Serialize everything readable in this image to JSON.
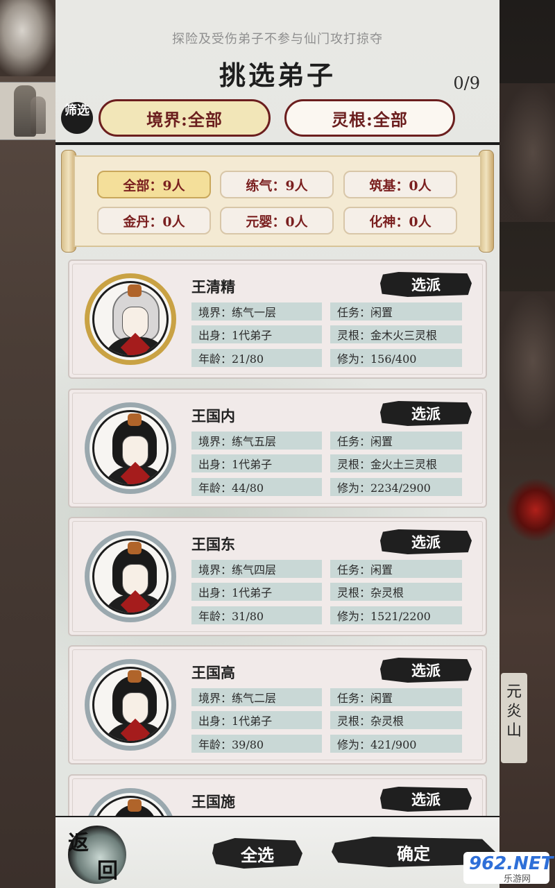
{
  "header": {
    "hint": "探险及受伤弟子不参与仙门攻打掠夺",
    "title": "挑选弟子",
    "count": "0/9",
    "filter_badge": "筛选",
    "realm_filter": "境界:全部",
    "root_filter": "灵根:全部"
  },
  "realm_tabs": [
    {
      "label": "全部：9人",
      "active": true
    },
    {
      "label": "练气：9人",
      "active": false
    },
    {
      "label": "筑基：0人",
      "active": false
    },
    {
      "label": "金丹：0人",
      "active": false
    },
    {
      "label": "元婴：0人",
      "active": false
    },
    {
      "label": "化神：0人",
      "active": false
    }
  ],
  "disciples": [
    {
      "name": "王清精",
      "assign": "选派",
      "realm": "境界：练气一层",
      "task": "任务：闲置",
      "origin": "出身：1代弟子",
      "root": "灵根：金木火三灵根",
      "age": "年龄：21/80",
      "cultivation": "修为：156/400"
    },
    {
      "name": "王国内",
      "assign": "选派",
      "realm": "境界：练气五层",
      "task": "任务：闲置",
      "origin": "出身：1代弟子",
      "root": "灵根：金火土三灵根",
      "age": "年龄：44/80",
      "cultivation": "修为：2234/2900"
    },
    {
      "name": "王国东",
      "assign": "选派",
      "realm": "境界：练气四层",
      "task": "任务：闲置",
      "origin": "出身：1代弟子",
      "root": "灵根：杂灵根",
      "age": "年龄：31/80",
      "cultivation": "修为：1521/2200"
    },
    {
      "name": "王国高",
      "assign": "选派",
      "realm": "境界：练气二层",
      "task": "任务：闲置",
      "origin": "出身：1代弟子",
      "root": "灵根：杂灵根",
      "age": "年龄：39/80",
      "cultivation": "修为：421/900"
    },
    {
      "name": "王国施",
      "assign": "选派"
    }
  ],
  "bottom": {
    "back_top": "返",
    "back_bottom": "回",
    "select_all": "全选",
    "confirm": "确定"
  },
  "side": {
    "place_name": "元炎山"
  },
  "watermark": {
    "number": "962.NET",
    "sub": "乐游网"
  },
  "colors": {
    "accent_dark_red": "#6b1e1e",
    "active_gold": "#f4df9a",
    "field_teal": "#c9d8d6",
    "ink": "#1f1f1f"
  }
}
